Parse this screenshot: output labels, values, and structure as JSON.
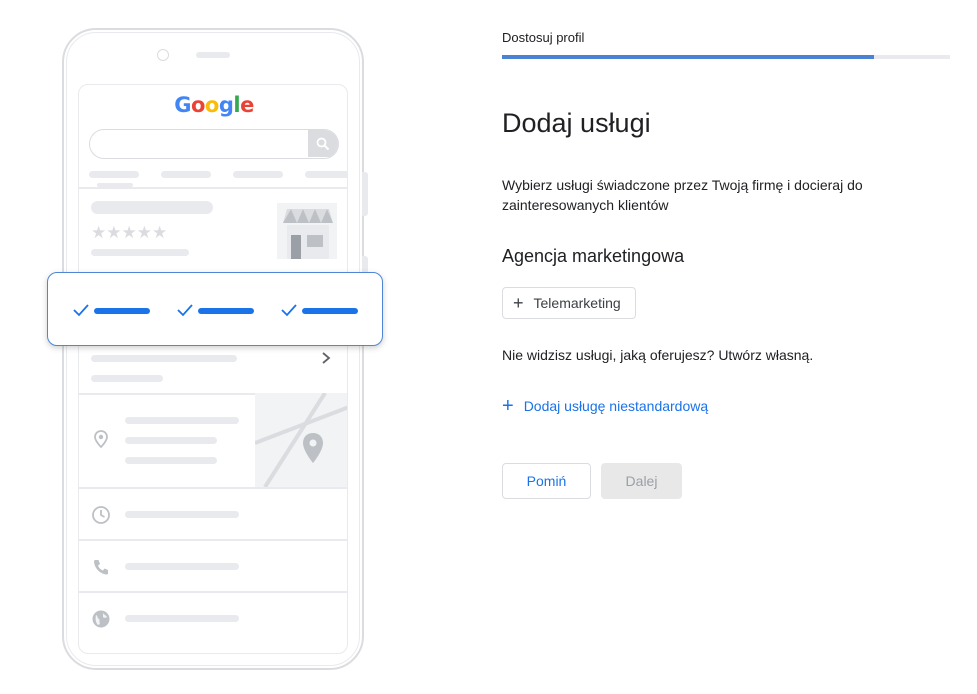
{
  "illustration": {
    "logo_text": "Google",
    "logo_letters": [
      {
        "char": "G",
        "color": "#4285F4"
      },
      {
        "char": "o",
        "color": "#EA4335"
      },
      {
        "char": "o",
        "color": "#FBBC05"
      },
      {
        "char": "g",
        "color": "#4285F4"
      },
      {
        "char": "l",
        "color": "#34A853"
      },
      {
        "char": "e",
        "color": "#EA4335"
      }
    ],
    "rating_stars": "★★★★★",
    "icons": [
      "search-icon",
      "shop-icon",
      "chevron-right-icon",
      "map-pin-icon",
      "map-icon",
      "clock-icon",
      "phone-icon",
      "globe-icon",
      "check-icon"
    ]
  },
  "header": {
    "step_title": "Dostosuj profil",
    "progress_fraction": 0.83
  },
  "main": {
    "title": "Dodaj usługi",
    "description": "Wybierz usługi świadczone przez Twoją firmę i docieraj do zainteresowanych klientów",
    "category": "Agencja marketingowa",
    "service_chip": {
      "icon": "plus-icon",
      "label": "Telemarketing"
    },
    "hint": "Nie widzisz usługi, jaką oferujesz? Utwórz własną.",
    "add_custom": {
      "icon": "plus-icon",
      "label": "Dodaj usługę niestandardową"
    }
  },
  "actions": {
    "skip_label": "Pomiń",
    "next_label": "Dalej"
  },
  "colors": {
    "accent": "#1a73e8",
    "progress": "#4a83d4",
    "disabled_bg": "#e8e8e8",
    "border": "#dadce0"
  }
}
